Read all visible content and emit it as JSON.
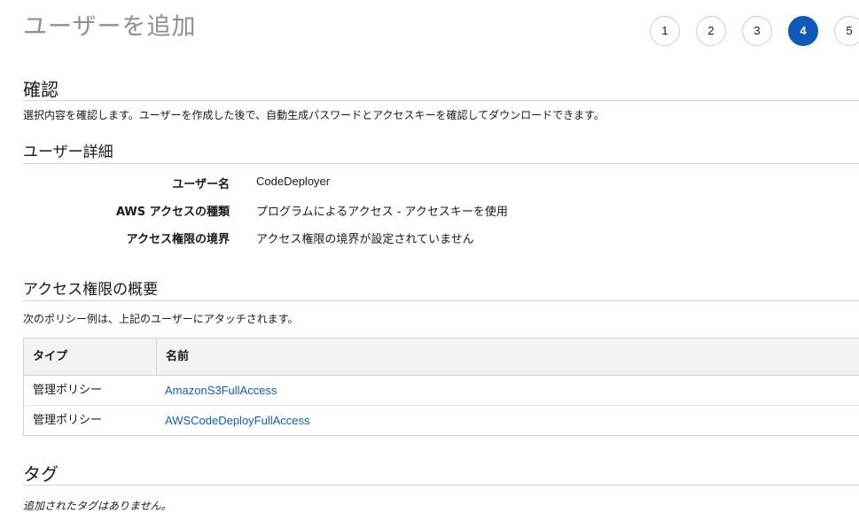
{
  "header": {
    "title": "ユーザーを追加",
    "steps": [
      {
        "label": "1",
        "active": false
      },
      {
        "label": "2",
        "active": false
      },
      {
        "label": "3",
        "active": false
      },
      {
        "label": "4",
        "active": true
      },
      {
        "label": "5",
        "active": false
      }
    ]
  },
  "review": {
    "heading": "確認",
    "description": "選択内容を確認します。ユーザーを作成した後で、自動生成パスワードとアクセスキーを確認してダウンロードできます。"
  },
  "user_details": {
    "heading": "ユーザー詳細",
    "rows": [
      {
        "label": "ユーザー名",
        "value": "CodeDeployer"
      },
      {
        "label": "AWS アクセスの種類",
        "value": "プログラムによるアクセス - アクセスキーを使用"
      },
      {
        "label": "アクセス権限の境界",
        "value": "アクセス権限の境界が設定されていません"
      }
    ]
  },
  "permissions": {
    "heading": "アクセス権限の概要",
    "description": "次のポリシー例は、上記のユーザーにアタッチされます。",
    "columns": [
      "タイプ",
      "名前"
    ],
    "rows": [
      {
        "type": "管理ポリシー",
        "name": "AmazonS3FullAccess"
      },
      {
        "type": "管理ポリシー",
        "name": "AWSCodeDeployFullAccess"
      }
    ]
  },
  "tags": {
    "heading": "タグ",
    "empty_text": "追加されたタグはありません。"
  },
  "colors": {
    "accent": "#0f5ab8",
    "link": "#0b60b9",
    "title_gray": "#8a8f94",
    "header_bg": "#f2f3f3",
    "border": "#cfd2d6"
  }
}
